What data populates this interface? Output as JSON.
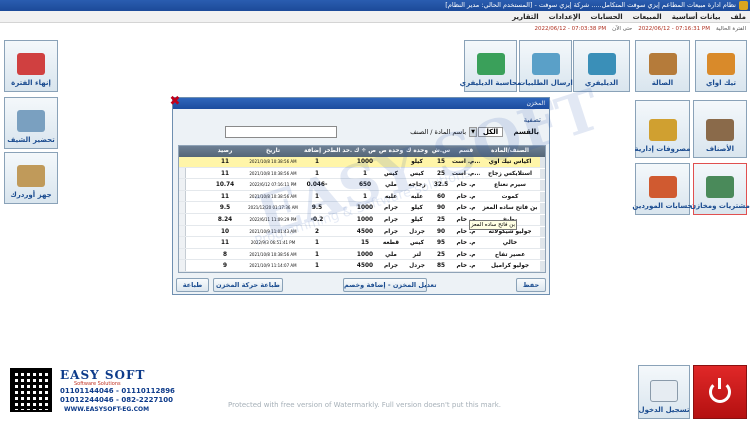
{
  "window_title": "نظام ادارة مبيعات المطاعم إيزي سوفت المتكامل..... شركة إيزي سوفت - [المستخدم الحالي: مدير النظام]",
  "menu": [
    "ملف",
    "بيانات أساسية",
    "المبيعات",
    "الحسابات",
    "الإعدادات",
    "التقارير"
  ],
  "status": {
    "period_label": "الفترة الحالية",
    "current_period": "2022/06/12 - 07:16:31 PM",
    "to_label": "حتى الآن",
    "session_time": "2022/06/12 - 07:03:38 PM"
  },
  "tiles_top": [
    "تيك اواي",
    "الصالة",
    "الديليفري",
    "ارسال الطلبيات",
    "محاسبة الديليفري"
  ],
  "tiles_right": [
    "الأصناف",
    "مصروفات إدارية",
    "مشتريات ومخازن",
    "حسابات الموردين"
  ],
  "tiles_left": [
    "إنهاء الفترة",
    "تحضير الشيف",
    "جهز أوردرك"
  ],
  "login_tile": "تسجيل الدخول",
  "store_window": {
    "title": "المخزن",
    "filter_label": "تصفية",
    "category_label": "بالقسم",
    "category_value": "الكل",
    "name_label": "باسم المادة / الصنف",
    "search_value": "",
    "columns": [
      "الصنف/المادة",
      "قسم",
      "س.ش",
      "وحدة ك",
      "وحدة ص",
      "ص ÷ ك",
      "حد الط...",
      "آخر إضافة",
      "تاريخ",
      "رصيد"
    ],
    "rows": [
      [
        "اكياس تيك اوي",
        "م. است...",
        "15",
        "كيلو",
        "",
        "1000",
        "",
        "1",
        "2021/10/8 10:38:56 AM",
        "11"
      ],
      [
        "استلايكس زجاج",
        "م. است...",
        "25",
        "كيس",
        "كيس",
        "1",
        "",
        "1",
        "2021/10/8 10:38:56 AM",
        "11"
      ],
      [
        "سيرم نعناع",
        "م. خام",
        "32.5",
        "زجاجه",
        "ملي",
        "650",
        "",
        "0.046-",
        "2022/6/12 07:16:11 PM",
        "10.74"
      ],
      [
        "كموت",
        "م. خام",
        "60",
        "علبه",
        "علبه",
        "1",
        "",
        "1",
        "2021/10/8 10:38:56 AM",
        "11"
      ],
      [
        "بن فاتح ساده المعز",
        "م. خام",
        "90",
        "كيلو",
        "جرام",
        "1000",
        "",
        "9.5",
        "2021/12/20 01:17:36 AM",
        "9.5"
      ],
      [
        "بطيخ",
        "م. خام",
        "25",
        "كيلو",
        "جرام",
        "1000",
        "",
        "-0.2",
        "2022/6/11 11:09:29 PM",
        "8.24"
      ],
      [
        "جوليو شيكولاته",
        "م. خام",
        "90",
        "جردل",
        "جرام",
        "4500",
        "",
        "2",
        "2021/10/9 11:01:43 AM",
        "10"
      ],
      [
        "خالي",
        "م. خام",
        "95",
        "كيس",
        "قطعه",
        "15",
        "",
        "1",
        "2022/9/3 06:51:41 PM",
        "11"
      ],
      [
        "عصير تفاح",
        "م. خام",
        "25",
        "لتر",
        "ملي",
        "1000",
        "",
        "1",
        "2021/10/8 10:38:56 AM",
        "8"
      ],
      [
        "جوليو كراميل",
        "م. خام",
        "85",
        "جردل",
        "جرام",
        "4500",
        "",
        "1",
        "2021/10/9 11:14:07 AM",
        "9"
      ]
    ],
    "tooltip": "بن فاتح ساده المعز",
    "buttons": {
      "save": "حفظ",
      "adjust": "تعديل المخزن - إضافة وخصم",
      "print_moves": "طباعة حركة المخزن",
      "print": "طباعة"
    }
  },
  "brand": {
    "name": "EASY SOFT",
    "tagline": "Software Solutions",
    "phone1": "01101144046 - 01110112896",
    "phone2": "01012244046 - 082-2227100",
    "website": "WWW.EASYSOFT-EG.COM"
  },
  "watermark_big": "EASY SOFT",
  "watermark_small": "Programming & Software solutions",
  "watermark_notice": "Protected with free version of Watermarkly. Full version doesn't put this mark.",
  "colors": {
    "accent": "#1c4a99",
    "status_red": "#b03020",
    "power": "#d01818"
  }
}
